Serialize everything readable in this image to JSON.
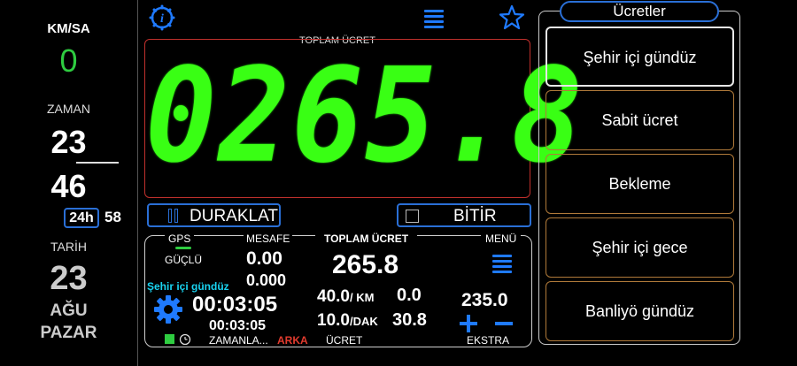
{
  "left": {
    "speed_label": "KM/SA",
    "speed_value": "0",
    "time_label": "ZAMAN",
    "hour": "23",
    "minute": "46",
    "format_badge": "24h",
    "seconds": "58",
    "date_label": "TARİH",
    "day": "23",
    "month": "AĞU",
    "weekday": "PAZAR"
  },
  "display": {
    "caption": "TOPLAM ÜCRET",
    "value": "0265.8"
  },
  "controls": {
    "pause_label": "DURAKLAT",
    "finish_label": "BİTİR"
  },
  "panel": {
    "gps_label": "GPS",
    "gps_status": "GÜÇLÜ",
    "distance_label": "MESAFE",
    "distance_main": "0.00",
    "distance_sub": "0.000",
    "active_tariff": "Şehir içi gündüz",
    "elapsed_main": "00:03:05",
    "elapsed_sub": "00:03:05",
    "timer_label": "ZAMANLA...",
    "back_label": "ARKA",
    "total_label": "TOPLAM ÜCRET",
    "total_value": "265.8",
    "rate_km": "40.0",
    "rate_km_unit": "/ KM",
    "rate_min": "10.0",
    "rate_min_unit": "/DAK",
    "fare_km": "0.0",
    "fare_time": "30.8",
    "fare_label": "ÜCRET",
    "menu_label": "MENÜ",
    "extra_value": "235.0",
    "extra_label": "EKSTRA"
  },
  "tariffs": {
    "title": "Ücretler",
    "items": [
      "Şehir içi gündüz",
      "Sabit ücret",
      "Bekleme",
      "Şehir içi gece",
      "Banliyö gündüz"
    ]
  },
  "colors": {
    "digits": "#39ff14",
    "accent": "#1f7aff",
    "border_red": "#c0302c",
    "tariff_border": "#b07a3a"
  }
}
